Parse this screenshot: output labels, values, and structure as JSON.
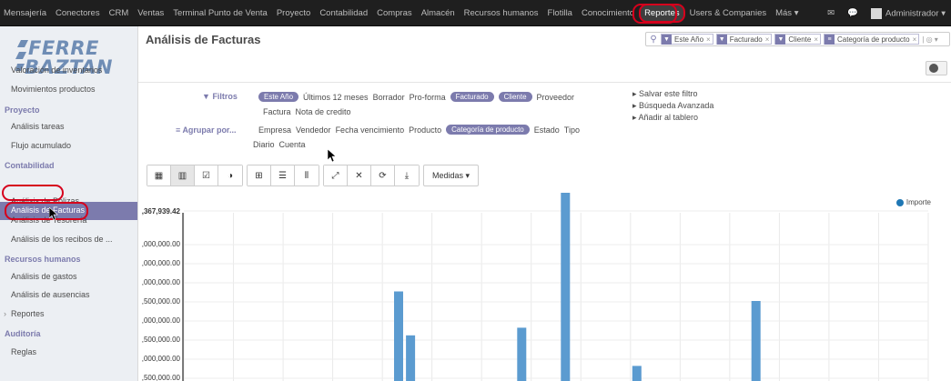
{
  "topbar": {
    "menu": [
      "Mensajería",
      "Conectores",
      "CRM",
      "Ventas",
      "Terminal Punto de Venta",
      "Proyecto",
      "Contabilidad",
      "Compras",
      "Almacén",
      "Recursos humanos",
      "Flotilla",
      "Conocimiento",
      "Reportes",
      "Users & Companies",
      "Más ▾"
    ],
    "active_index": 12,
    "user": "Administrador ▾"
  },
  "sidebar": {
    "logo": [
      "FERRE",
      "BAZTAN"
    ],
    "items": [
      {
        "type": "item",
        "label": "Valoración de inventarios"
      },
      {
        "type": "item",
        "label": "Movimientos productos"
      },
      {
        "type": "head",
        "label": "Proyecto"
      },
      {
        "type": "item",
        "label": "Análisis tareas"
      },
      {
        "type": "item",
        "label": "Flujo acumulado"
      },
      {
        "type": "head",
        "label": "Contabilidad"
      },
      {
        "type": "active",
        "label": "Análisis de Facturas"
      },
      {
        "type": "item",
        "label": "Análisis de Polizas"
      },
      {
        "type": "item",
        "label": "Análisis de Tesorería"
      },
      {
        "type": "item",
        "label": "Análisis de los recibos de ..."
      },
      {
        "type": "head",
        "label": "Recursos humanos"
      },
      {
        "type": "item",
        "label": "Análisis de gastos"
      },
      {
        "type": "item",
        "label": "Análisis de ausencias"
      },
      {
        "type": "item",
        "label": "Reportes"
      },
      {
        "type": "head",
        "label": "Auditoría"
      },
      {
        "type": "item",
        "label": "Reglas"
      }
    ]
  },
  "control_panel": {
    "title": "Análisis de Facturas",
    "facets": [
      "Este Año",
      "Facturado",
      "Cliente",
      "Categoría de producto"
    ],
    "search_extra": "| ◎ ▾"
  },
  "filters": {
    "label": "Filtros",
    "row1": [
      {
        "text": "Este Año",
        "pill": true
      },
      {
        "text": "Últimos 12 meses",
        "pill": false
      },
      {
        "text": "Borrador",
        "pill": false
      },
      {
        "text": "Pro-forma",
        "pill": false
      },
      {
        "text": "Facturado",
        "pill": true
      },
      {
        "text": "Cliente",
        "pill": true
      },
      {
        "text": "Proveedor",
        "pill": false
      }
    ],
    "row2": [
      "Factura",
      "Nota de credito"
    ]
  },
  "groupby": {
    "label": "Agrupar por...",
    "row1": [
      {
        "text": "Empresa",
        "pill": false
      },
      {
        "text": "Vendedor",
        "pill": false
      },
      {
        "text": "Fecha vencimiento",
        "pill": false
      },
      {
        "text": "Producto",
        "pill": false
      },
      {
        "text": "Categoría de producto",
        "pill": true
      },
      {
        "text": "Estado",
        "pill": false
      },
      {
        "text": "Tipo",
        "pill": false
      }
    ],
    "row2": [
      "Diario",
      "Cuenta"
    ]
  },
  "favorites": [
    "▸ Salvar este filtro",
    "▸ Búsqueda Avanzada",
    "▸ Añadir al tablero"
  ],
  "toolbar": {
    "medidas_label": "Medidas ▾"
  },
  "chart_data": {
    "type": "bar",
    "legend": "Importe",
    "legend_position": "top-right",
    "y_tick_labels": [
      ",367,939.42",
      ",000,000.00",
      ",000,000.00",
      ",000,000.00",
      ",500,000.00",
      ",000,000.00",
      ",500,000.00",
      ",000,000.00",
      ",500,000.00",
      ",000,000.00"
    ],
    "y_top": 9367939.42,
    "y_tick_values": [
      9000000,
      8000000,
      7000000,
      6000000,
      5000000,
      4000000,
      3000000,
      2000000
    ],
    "bars": [
      {
        "slot": 5.2,
        "value": 4250000
      },
      {
        "slot": 5.5,
        "value": 3100000
      },
      {
        "slot": 8.3,
        "value": 3300000
      },
      {
        "slot": 9.4,
        "value": 9200000
      },
      {
        "slot": 11.2,
        "value": 2300000
      },
      {
        "slot": 14.2,
        "value": 4000000
      }
    ],
    "grid": true
  }
}
